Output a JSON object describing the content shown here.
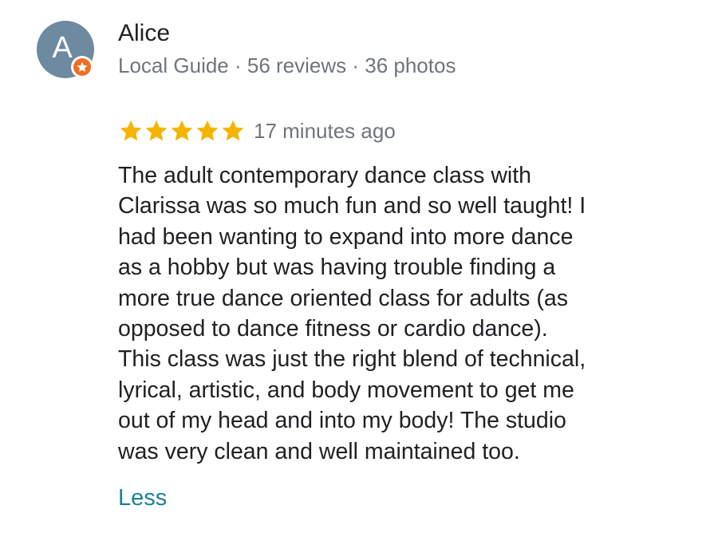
{
  "reviewer": {
    "initial": "A",
    "name": "Alice",
    "meta": "Local Guide · 56 reviews · 36 photos",
    "avatar_color": "#6e8aa0",
    "badge_color": "#f06d21",
    "badge_icon": "star-icon"
  },
  "rating": {
    "stars": 5,
    "max_stars": 5,
    "star_color": "#f5b400",
    "time_ago": "17 minutes ago"
  },
  "review": {
    "lines": [
      "The adult contemporary dance class with",
      "Clarissa was so much fun and so well taught! I",
      "had been wanting to expand into more dance",
      "as a hobby but was having trouble finding a",
      "more true dance oriented class for adults (as",
      "opposed to dance fitness or cardio dance).",
      "This class was just the right blend of technical,",
      "lyrical, artistic, and body movement to get me",
      "out of my head and into my body! The studio",
      "was very clean and well maintained too."
    ]
  },
  "actions": {
    "less_label": "Less",
    "link_color": "#1a7f9c"
  }
}
